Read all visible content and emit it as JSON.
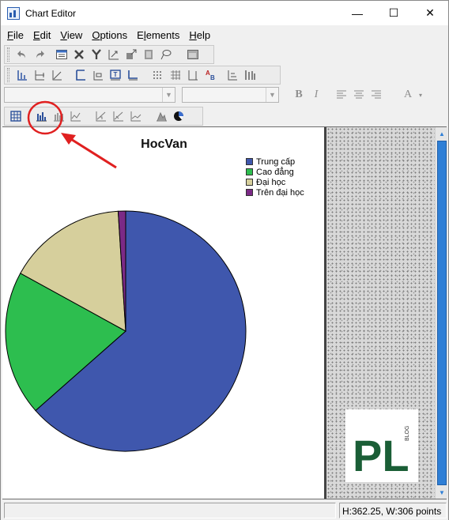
{
  "window": {
    "title": "Chart Editor",
    "minimize": "—",
    "maximize": "☐",
    "close": "✕"
  },
  "menu": [
    {
      "label": "File",
      "key": "F"
    },
    {
      "label": "Edit",
      "key": "E"
    },
    {
      "label": "View",
      "key": "V"
    },
    {
      "label": "Options",
      "key": "O"
    },
    {
      "label": "Elements",
      "key": "l"
    },
    {
      "label": "Help",
      "key": "H"
    }
  ],
  "format": {
    "bold": "B",
    "italic": "I",
    "text_color": "A"
  },
  "chart_data": {
    "type": "pie",
    "title": "HocVan",
    "categories": [
      "Trung cấp",
      "Cao đẳng",
      "Đại học",
      "Trên đại học"
    ],
    "values": [
      63.5,
      19.5,
      16.0,
      1.0
    ],
    "colors": [
      "#3f57ad",
      "#2dbe4f",
      "#d6cf9c",
      "#7b2a86"
    ],
    "legend_position": "top-right"
  },
  "logo": {
    "text": "PL",
    "tag": "BLOG",
    "color": "#1a5e36"
  },
  "status": {
    "left": "",
    "right": "H:362.25, W:306 points"
  },
  "annotation": {
    "color": "#e02020"
  }
}
